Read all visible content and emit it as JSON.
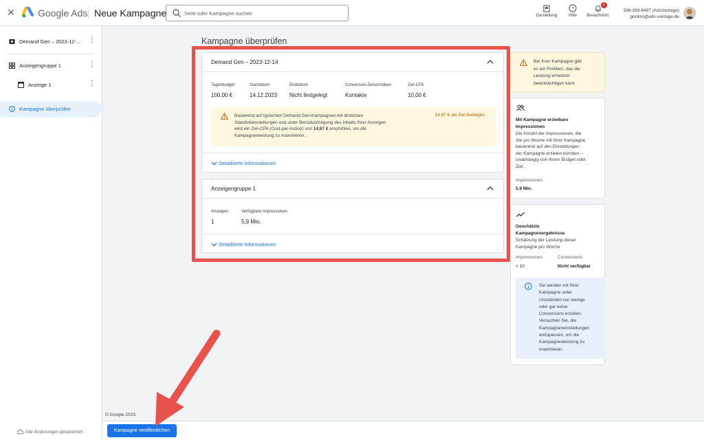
{
  "header": {
    "close_icon": "close-icon",
    "app_name": "Google Ads",
    "page_name": "Neue Kampagne",
    "search_placeholder": "Seite oder Kampagne suchen",
    "actions": [
      {
        "label": "Darstellung",
        "icon": "appearance-icon"
      },
      {
        "label": "Hilfe",
        "icon": "help-icon"
      },
      {
        "label": "Benachricht.",
        "icon": "bell-icon",
        "badge": "1"
      }
    ],
    "account_id": "336-299-6497 (AdsVantage)",
    "account_email": "gordon@ads-vantage.de"
  },
  "sidebar": {
    "items": [
      {
        "label": "Demand Gen – 2023-12-...",
        "icon": "campaign-icon"
      },
      {
        "label": "Anzeigengruppe 1",
        "icon": "ad-group-icon"
      },
      {
        "label": "Anzeige 1",
        "icon": "ad-icon"
      },
      {
        "label": "Kampagne überprüfen",
        "icon": "info-icon"
      }
    ],
    "saved_status": "Alle Änderungen gespeichert"
  },
  "main": {
    "title": "Kampagne überprüfen",
    "campaign_card": {
      "title": "Demand Gen – 2023-12-14",
      "fields": [
        {
          "label": "Tagesbudget",
          "value": "100,00 €"
        },
        {
          "label": "Startdatum",
          "value": "14.12.2023"
        },
        {
          "label": "Enddatum",
          "value": "Nicht festgelegt"
        },
        {
          "label": "Conversion-Zielvorhaben",
          "value": "Kontakte"
        },
        {
          "label": "Ziel-CPA",
          "value": "10,00 €"
        }
      ],
      "warning_line1": "Basierend auf typischen Demand Gen-Kampagnen mit ähnlichen",
      "warning_line2": "Standorteinstellungen und unter Berücksichtigung des Inhalts Ihrer Anzeigen",
      "warning_line3_pre": "wird ein Ziel-CPA (Cost-per-Action) von",
      "warning_line3_bold": "14,87 €",
      "warning_line3_post": "empfohlen, um die",
      "warning_line4": "Kampagnenleistung zu maximieren.",
      "warning_action": "14,87 € als Ziel festlegen",
      "details_link": "Detaillierte Informationen"
    },
    "adgroup_card": {
      "title": "Anzeigengruppe 1",
      "fields": [
        {
          "label": "Anzeigen",
          "value": "1"
        },
        {
          "label": "Verfügbare Impressionen",
          "value": "5,9 Mio."
        }
      ],
      "details_link": "Detaillierte Informationen"
    }
  },
  "right_panel": {
    "alert": {
      "line1": "Bei Ihrer Kampagne gibt",
      "line2": "es ein Problem, das die",
      "line3": "Leistung erheblich",
      "line4": "beeinträchtigen kann"
    },
    "impressions": {
      "icon": "people-icon",
      "title_line1": "Mit Kampagne erzielbare",
      "title_line2": "Impressionen",
      "text_lines": [
        "Die Anzahl der Impressionen, die",
        "Sie pro Woche mit Ihrer Kampagne",
        "basierend auf den Einstellungen",
        "der Kampagne erzielen könnten –",
        "unabhängig von Ihrem Budget oder",
        "Ziel."
      ],
      "label": "Impressionen",
      "value": "5,9 Mio."
    },
    "results": {
      "icon": "trending-icon",
      "title_line1": "Geschätzte",
      "title_line2": "Kampagnenergebnisse",
      "text_line1": "Schätzung der Leistung dieser",
      "text_line2": "Kampagne pro Woche",
      "impressions_label": "Impressionen",
      "impressions_value": "< 10",
      "conversions_label": "Conversions",
      "conversions_value": "Nicht verfügbar",
      "info_lines": [
        "Sie werden mit Ihrer",
        "Kampagne unter",
        "Umständen nur wenige",
        "oder gar keine",
        "Conversions erzielen.",
        "Versuchen Sie, die",
        "Kampagneneinstellungen",
        "anzupassen, um die",
        "Kampagnenleistung zu",
        "maximieren."
      ]
    }
  },
  "footer": {
    "copyright": "© Google 2023.",
    "publish_button": "Kampagne veröffentlichen"
  },
  "colors": {
    "accent": "#1a73e8",
    "highlight_frame": "#e8524a",
    "warning_bg": "#fef7e0",
    "info_bg": "#e8f0fe"
  }
}
